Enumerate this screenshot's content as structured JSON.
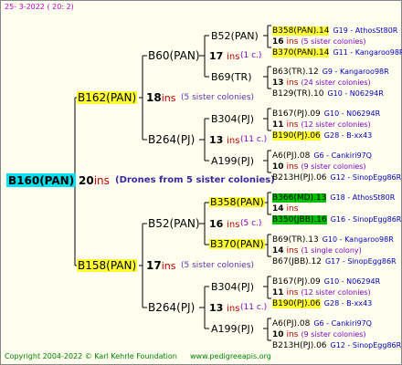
{
  "header": {
    "date": "25-  3-2022 ( 20:  2)"
  },
  "root": {
    "id": "B160(PAN)",
    "ins_num": "20",
    "ins_label": "ins",
    "note": "(Drones from 5 sister colonies)"
  },
  "gen1": [
    {
      "id": "B162(PAN)",
      "ins_num": "18",
      "ins_label": "ins",
      "note": "(5 sister colonies)"
    },
    {
      "id": "B158(PAN)",
      "ins_num": "17",
      "ins_label": "ins",
      "note": "(5 sister colonies)"
    }
  ],
  "gen2": [
    {
      "id": "B60(PAN)",
      "ins_num": "17",
      "ins_label": "ins",
      "note": "(1 c.)"
    },
    {
      "id": "B264(PJ)",
      "ins_num": "13",
      "ins_label": "ins",
      "note": "(11 c.)"
    },
    {
      "id": "B52(PAN)",
      "ins_num": "16",
      "ins_label": "ins",
      "note": "(5 c.)"
    },
    {
      "id": "B264(PJ)",
      "ins_num": "13",
      "ins_label": "ins",
      "note": "(11 c.)"
    }
  ],
  "gen3": [
    {
      "id": "B52(PAN)"
    },
    {
      "id": "B69(TR)"
    },
    {
      "id": "B304(PJ)"
    },
    {
      "id": "A199(PJ)"
    },
    {
      "id": "B358(PAN)"
    },
    {
      "id": "B370(PAN)"
    },
    {
      "id": "B304(PJ)"
    },
    {
      "id": "A199(PJ)"
    }
  ],
  "gen4": [
    {
      "top": "B358(PAN).14",
      "top_src": "G19 - AthosSt80R",
      "mid_num": "16",
      "mid_label": "ins",
      "mid_note": "(5 sister colonies)",
      "bot": "B370(PAN).14",
      "bot_src": "G11 - Kangaroo98R"
    },
    {
      "top": "B63(TR).12",
      "top_src": "G9 - Kangaroo98R",
      "mid_num": "13",
      "mid_label": "ins",
      "mid_note": "(24 sister colonies)",
      "bot": "B129(TR).10",
      "bot_src": "G10 - N06294R"
    },
    {
      "top": "B167(PJ).09",
      "top_src": "G10 - N06294R",
      "mid_num": "11",
      "mid_label": "ins",
      "mid_note": "(12 sister colonies)",
      "bot": "B190(PJ).06",
      "bot_src": "G28 - B-xx43"
    },
    {
      "top": "A6(PJ).08",
      "top_src": "G6 - Cankiri97Q",
      "mid_num": "10",
      "mid_label": "ins",
      "mid_note": "(9 sister colonies)",
      "bot": "B213H(PJ).06",
      "bot_src": "G12 - SinopEgg86R"
    },
    {
      "top": "B366(MD).13",
      "top_src": "G18 - AthosSt80R",
      "mid_num": "14",
      "mid_label": "ins",
      "mid_note": "",
      "bot": "B350(JBB).16",
      "bot_src": "G16 - SinopEgg86R"
    },
    {
      "top": "B69(TR).13",
      "top_src": "G10 - Kangaroo98R",
      "mid_num": "14",
      "mid_label": "ins",
      "mid_note": "(1 single colony)",
      "bot": "B67(JBB).12",
      "bot_src": "G17 - SinopEgg86R"
    },
    {
      "top": "B167(PJ).09",
      "top_src": "G10 - N06294R",
      "mid_num": "11",
      "mid_label": "ins",
      "mid_note": "(12 sister colonies)",
      "bot": "B190(PJ).06",
      "bot_src": "G28 - B-xx43"
    },
    {
      "top": "A6(PJ).08",
      "top_src": "G6 - Cankiri97Q",
      "mid_num": "10",
      "mid_label": "ins",
      "mid_note": "(9 sister colonies)",
      "bot": "B213H(PJ).06",
      "bot_src": "G12 - SinopEgg86R"
    }
  ],
  "footer": {
    "copyright": "Copyright 2004-2022 © Karl Kehrle Foundation",
    "url": "www.pedigreeapis.org"
  },
  "colors": {
    "root_bg": "#00e0f0",
    "highlight": "#ffff33",
    "green_highlight": "#00c000",
    "ins_red": "#c00000",
    "note_purple": "#6030b0",
    "source_blue": "#0000c0",
    "footer_green": "#008000"
  }
}
